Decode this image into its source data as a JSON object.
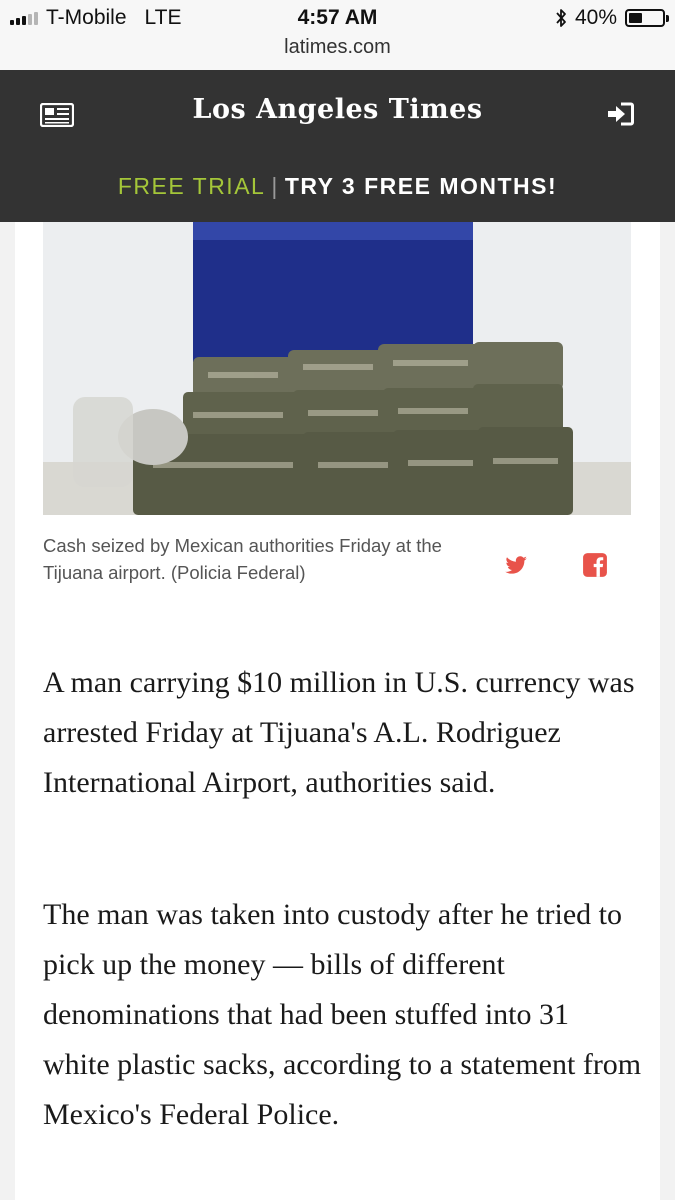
{
  "status_bar": {
    "carrier": "T-Mobile",
    "network": "LTE",
    "time": "4:57 AM",
    "url": "latimes.com",
    "bluetooth_icon": "bluetooth-icon",
    "battery_text": "40%",
    "battery_level": 0.4,
    "signal_bars_active": 3,
    "signal_bars_total": 5
  },
  "header": {
    "left_icon": "newspaper-icon",
    "logo_text": "Los Angeles Times",
    "right_icon": "login-icon",
    "promo_free": "FREE TRIAL",
    "promo_separator": "|",
    "promo_cta": "TRY 3 FREE MONTHS!",
    "background": "#333333",
    "accent": "#a4c639"
  },
  "article": {
    "image_caption": "Cash seized by Mexican authorities Friday at the Tijuana airport. (Policia Federal)",
    "share_icons": [
      "twitter-icon",
      "facebook-icon"
    ],
    "share_color": "#e8534a",
    "paragraphs": [
      "A man carrying $10 million in U.S. currency was arrested Friday at Tijuana's A.L. Rodriguez International Airport, authorities said.",
      "The man was taken into custody after he tried to pick up the money — bills of different denominations that had been stuffed into 31 white plastic sacks, according to a statement from Mexico's Federal Police."
    ]
  }
}
